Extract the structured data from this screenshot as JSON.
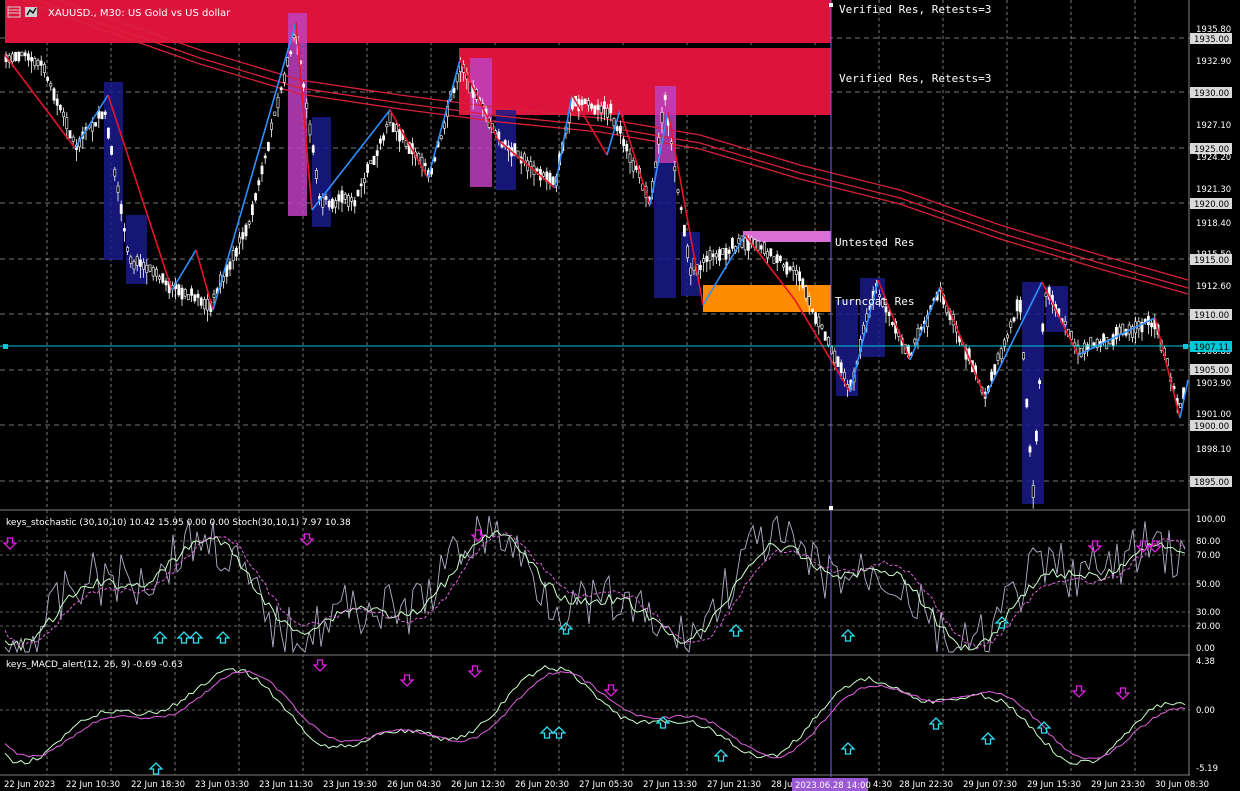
{
  "header": {
    "symbol_text": "XAUUSD., M30:  US Gold vs US dollar"
  },
  "main_panel": {
    "price_labels": [
      "1935.80",
      "1935.00",
      "1932.90",
      "1930.00",
      "1927.10",
      "1925.00",
      "1924.20",
      "1921.30",
      "1920.00",
      "1918.40",
      "1915.50",
      "1915.00",
      "1912.60",
      "1910.00",
      "1906.80",
      "1905.00",
      "1903.90",
      "1901.00",
      "1900.00",
      "1898.10",
      "1895.00"
    ],
    "current_price": "1907.11",
    "zones": [
      {
        "label": "Verified Res, Retests=3",
        "color": "#dc143c"
      },
      {
        "label": "Verified Res, Retests=3",
        "color": "#dc143c"
      },
      {
        "label": "Untested Res",
        "color": "#da70d6"
      },
      {
        "label": "Turncoat Res",
        "color": "#ff8c00"
      }
    ]
  },
  "stochastic_panel": {
    "title": "keys_stochastic (30,10,10) 10.42 15.95 0.00 0.00 Stoch(30,10,1) 7.97 10.38",
    "levels": [
      "100.00",
      "80.00",
      "70.00",
      "50.00",
      "30.00",
      "20.00",
      "0.00"
    ]
  },
  "macd_panel": {
    "title": "keys_MACD_alert(12, 26, 9) -0.69 -0.63",
    "levels": [
      "4.38",
      "0.00",
      "-5.19"
    ]
  },
  "time_axis": {
    "labels": [
      "22 Jun 2023",
      "22 Jun 10:30",
      "22 Jun 18:30",
      "23 Jun 03:30",
      "23 Jun 11:30",
      "23 Jun 19:30",
      "26 Jun 04:30",
      "26 Jun 12:30",
      "26 Jun 20:30",
      "27 Jun 05:30",
      "27 Jun 13:30",
      "27 Jun 21:30",
      "28 Ju",
      "4:30",
      "28 Jun 22:30",
      "29 Jun 07:30",
      "29 Jun 15:30",
      "29 Jun 23:30",
      "30 Jun 08:30"
    ],
    "cursor_label": "2023.06.28 14:00"
  },
  "colors": {
    "background": "#000000",
    "grid": "#c0c0c0",
    "zigzag_down": "#e8142a",
    "zigzag_up": "#2e90ff",
    "ma": "#d8203a",
    "crosshair": "#7b5cff",
    "current_price": "#00c8d8",
    "price_box": "#d9d9d9",
    "cursor_box": "#9b59d6",
    "arrow_down": "#e020e0",
    "arrow_up": "#30e0f0"
  },
  "icons": [
    "window-icon",
    "chart-icon"
  ]
}
